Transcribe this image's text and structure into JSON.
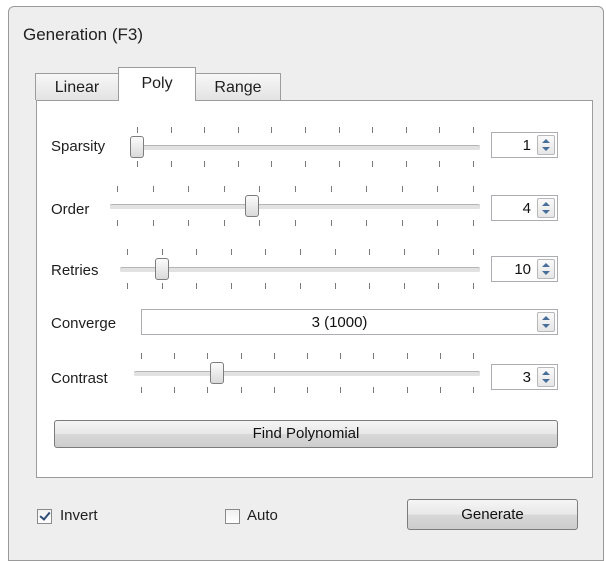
{
  "window": {
    "title": "Generation (F3)"
  },
  "tabs": [
    {
      "label": "Linear",
      "active": false
    },
    {
      "label": "Poly",
      "active": true
    },
    {
      "label": "Range",
      "active": false
    }
  ],
  "poly": {
    "sparsity": {
      "label": "Sparsity",
      "value": "1",
      "slider_fraction": 0.0
    },
    "order": {
      "label": "Order",
      "value": "4",
      "slider_fraction": 0.38
    },
    "retries": {
      "label": "Retries",
      "value": "10",
      "slider_fraction": 0.1
    },
    "converge": {
      "label": "Converge",
      "value": "3 (1000)"
    },
    "contrast": {
      "label": "Contrast",
      "value": "3",
      "slider_fraction": 0.23
    },
    "find_button": "Find Polynomial"
  },
  "footer": {
    "invert": {
      "label": "Invert",
      "checked": true
    },
    "auto": {
      "label": "Auto",
      "checked": false
    },
    "generate_button": "Generate"
  },
  "icons": [
    "spin-up-icon",
    "spin-down-icon",
    "checkmark-icon"
  ]
}
